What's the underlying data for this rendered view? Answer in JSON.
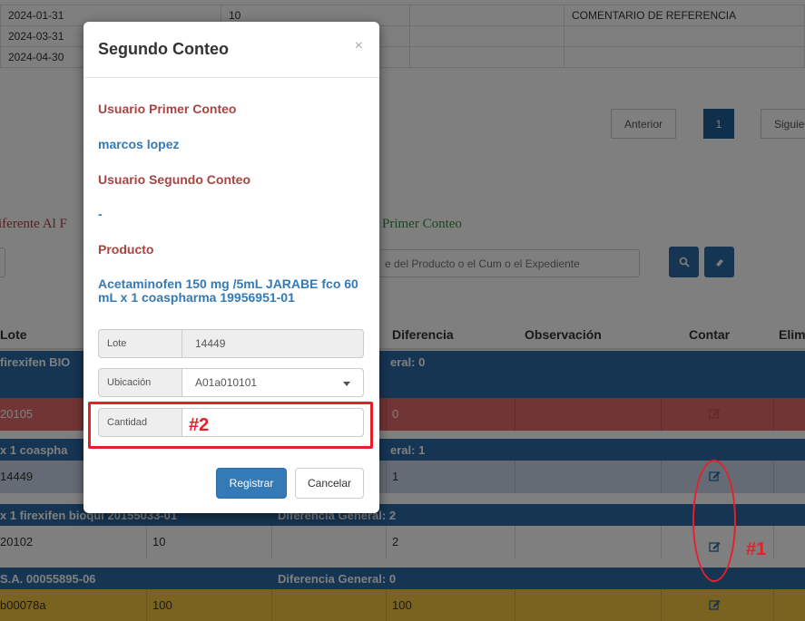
{
  "background": {
    "ref_rows": [
      {
        "date": "2024-01-31",
        "value": "10",
        "comment": "COMENTARIO DE REFERENCIA"
      },
      {
        "date": "2024-03-31",
        "value": "",
        "comment": ""
      },
      {
        "date": "2024-04-30",
        "value": "",
        "comment": ""
      }
    ],
    "pagination": {
      "prev": "Anterior",
      "current": "1",
      "next": "Siguie"
    },
    "tab_left": "iferente Al F",
    "tab_right": "Primer Conteo",
    "search_placeholder": "e del Producto o el Cum o el Expediente",
    "table_headers": {
      "lote": "Lote",
      "diferencia": "Diferencia",
      "observacion": "Observación",
      "contar": "Contar",
      "eliminar": "Elim"
    },
    "groups": [
      {
        "left": "firexifen BIO",
        "right": "eral: 0"
      },
      {
        "left": "x 1 coaspha",
        "right": "eral: 1"
      },
      {
        "left": "x 1 firexifen bioqui 20155033-01",
        "right": "Diferencia General: 2"
      },
      {
        "left": "S.A. 00055895-06",
        "right": "Diferencia General: 0"
      }
    ],
    "rows": [
      {
        "lote": "20105",
        "cantidad": "",
        "diferencia": "0"
      },
      {
        "lote": "14449",
        "cantidad": "",
        "diferencia": "1"
      },
      {
        "lote": "20102",
        "cantidad": "10",
        "diferencia": "2"
      },
      {
        "lote": "b00078a",
        "cantidad": "100",
        "diferencia": "100"
      }
    ]
  },
  "modal": {
    "title": "Segundo Conteo",
    "close": "×",
    "usuario_primer_label": "Usuario Primer Conteo",
    "usuario_primer_value": "marcos lopez",
    "usuario_segundo_label": "Usuario Segundo Conteo",
    "usuario_segundo_value": "-",
    "producto_label": "Producto",
    "producto_value": "Acetaminofen 150 mg /5mL JARABE fco 60 mL x 1 coaspharma 19956951-01",
    "lote_label": "Lote",
    "lote_value": "14449",
    "ubicacion_label": "Ubicación",
    "ubicacion_value": "A01a010101",
    "cantidad_label": "Cantidad",
    "cantidad_value": "",
    "registrar": "Registrar",
    "cancelar": "Cancelar"
  },
  "annotations": {
    "one": "#1",
    "two": "#2",
    "color": "#e5202a"
  }
}
